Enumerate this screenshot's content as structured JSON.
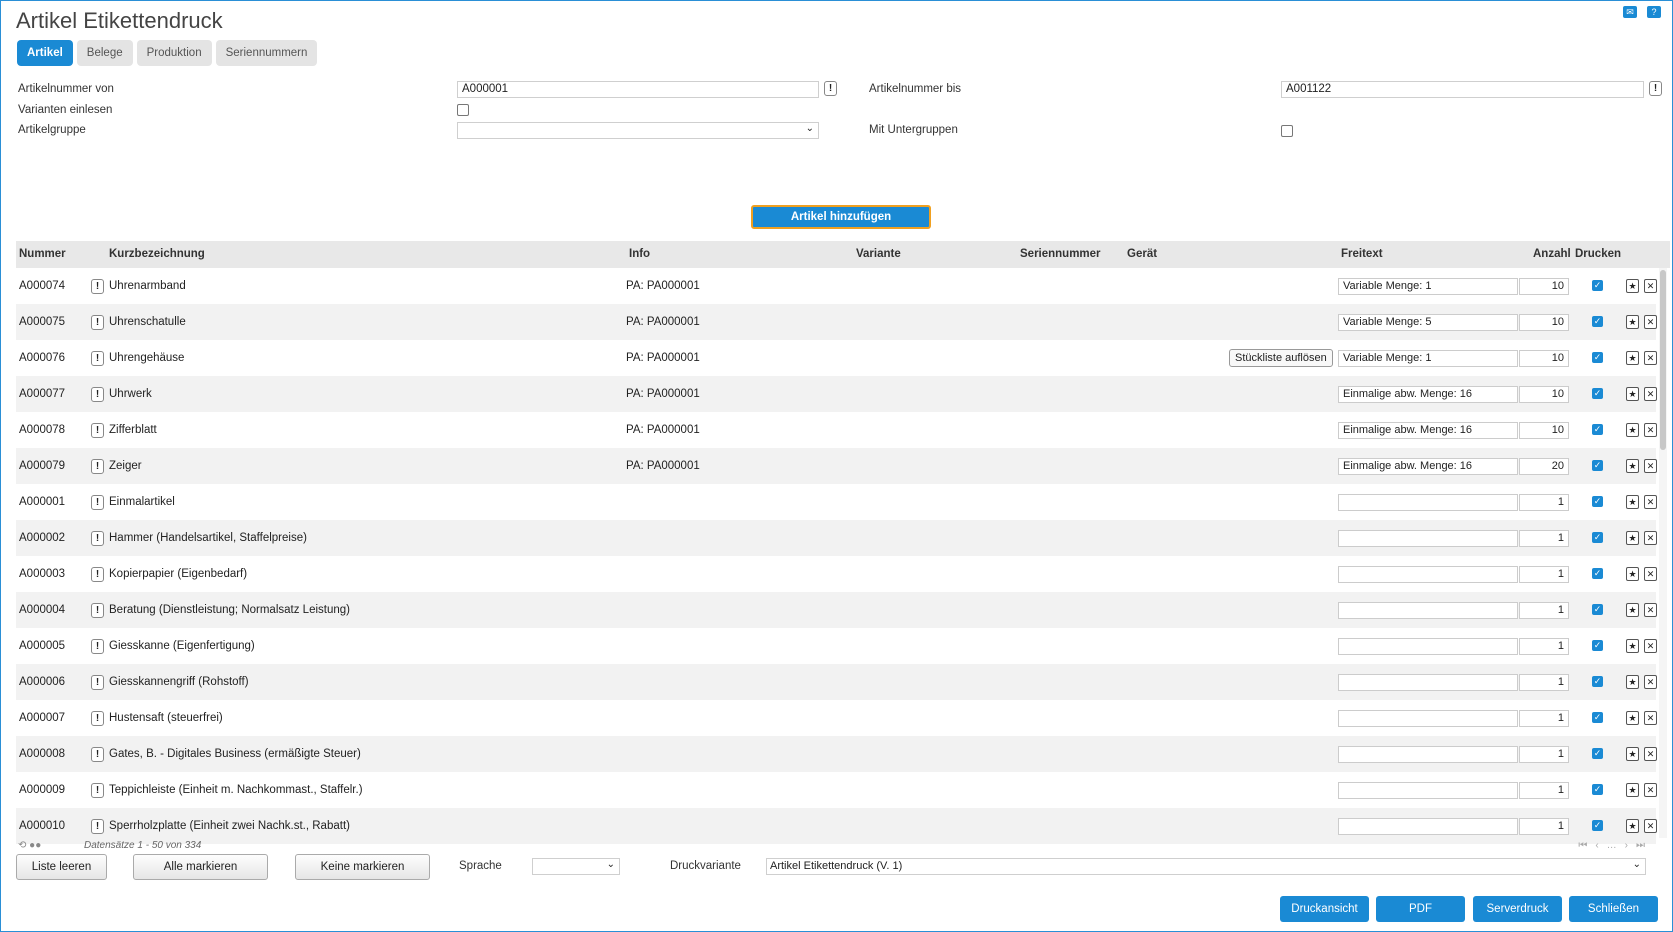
{
  "title": "Artikel Etikettendruck",
  "tabs": [
    "Artikel",
    "Belege",
    "Produktion",
    "Seriennummern"
  ],
  "form": {
    "nr_from_label": "Artikelnummer von",
    "nr_from_value": "A000001",
    "nr_to_label": "Artikelnummer bis",
    "nr_to_value": "A001122",
    "variants_label": "Varianten einlesen",
    "group_label": "Artikelgruppe",
    "subgroups_label": "Mit Untergruppen",
    "excl": "!"
  },
  "add_button": "Artikel hinzufügen",
  "columns": {
    "nummer": "Nummer",
    "kurz": "Kurzbezeichnung",
    "info": "Info",
    "variante": "Variante",
    "serien": "Seriennummer",
    "geraet": "Gerät",
    "freitext": "Freitext",
    "anzahl": "Anzahl",
    "drucken": "Drucken"
  },
  "rows": [
    {
      "nr": "A000074",
      "name": "Uhrenarmband",
      "info": "PA: PA000001",
      "btn": "",
      "free": "Variable Menge: 1",
      "qty": "10"
    },
    {
      "nr": "A000075",
      "name": "Uhrenschatulle",
      "info": "PA: PA000001",
      "btn": "",
      "free": "Variable Menge: 5",
      "qty": "10"
    },
    {
      "nr": "A000076",
      "name": "Uhrengehäuse",
      "info": "PA: PA000001",
      "btn": "Stückliste auflösen",
      "free": "Variable Menge: 1",
      "qty": "10"
    },
    {
      "nr": "A000077",
      "name": "Uhrwerk",
      "info": "PA: PA000001",
      "btn": "",
      "free": "Einmalige abw. Menge: 16",
      "qty": "10"
    },
    {
      "nr": "A000078",
      "name": "Zifferblatt",
      "info": "PA: PA000001",
      "btn": "",
      "free": "Einmalige abw. Menge: 16",
      "qty": "10"
    },
    {
      "nr": "A000079",
      "name": "Zeiger",
      "info": "PA: PA000001",
      "btn": "",
      "free": "Einmalige abw. Menge: 16",
      "qty": "20"
    },
    {
      "nr": "A000001",
      "name": "Einmalartikel",
      "info": "",
      "btn": "",
      "free": "",
      "qty": "1"
    },
    {
      "nr": "A000002",
      "name": "Hammer (Handelsartikel, Staffelpreise)",
      "info": "",
      "btn": "",
      "free": "",
      "qty": "1"
    },
    {
      "nr": "A000003",
      "name": "Kopierpapier (Eigenbedarf)",
      "info": "",
      "btn": "",
      "free": "",
      "qty": "1"
    },
    {
      "nr": "A000004",
      "name": "Beratung (Dienstleistung; Normalsatz Leistung)",
      "info": "",
      "btn": "",
      "free": "",
      "qty": "1"
    },
    {
      "nr": "A000005",
      "name": "Giesskanne (Eigenfertigung)",
      "info": "",
      "btn": "",
      "free": "",
      "qty": "1"
    },
    {
      "nr": "A000006",
      "name": "Giesskannengriff (Rohstoff)",
      "info": "",
      "btn": "",
      "free": "",
      "qty": "1"
    },
    {
      "nr": "A000007",
      "name": "Hustensaft (steuerfrei)",
      "info": "",
      "btn": "",
      "free": "",
      "qty": "1"
    },
    {
      "nr": "A000008",
      "name": "Gates, B. - Digitales Business (ermäßigte Steuer)",
      "info": "",
      "btn": "",
      "free": "",
      "qty": "1"
    },
    {
      "nr": "A000009",
      "name": "Teppichleiste (Einheit m. Nachkommast., Staffelr.)",
      "info": "",
      "btn": "",
      "free": "",
      "qty": "1"
    },
    {
      "nr": "A000010",
      "name": "Sperrholzplatte (Einheit zwei Nachk.st., Rabatt)",
      "info": "",
      "btn": "",
      "free": "",
      "qty": "1"
    }
  ],
  "pager_text": "Datensätze 1 - 50 von 334",
  "bottom": {
    "clear": "Liste leeren",
    "mark_all": "Alle markieren",
    "mark_none": "Keine markieren",
    "lang_label": "Sprache",
    "variant_label": "Druckvariante",
    "variant_value": "Artikel Etikettendruck (V. 1)"
  },
  "actions": [
    "Druckansicht",
    "PDF",
    "Serverdruck",
    "Schließen"
  ],
  "accent_color": "#1a8ad4"
}
